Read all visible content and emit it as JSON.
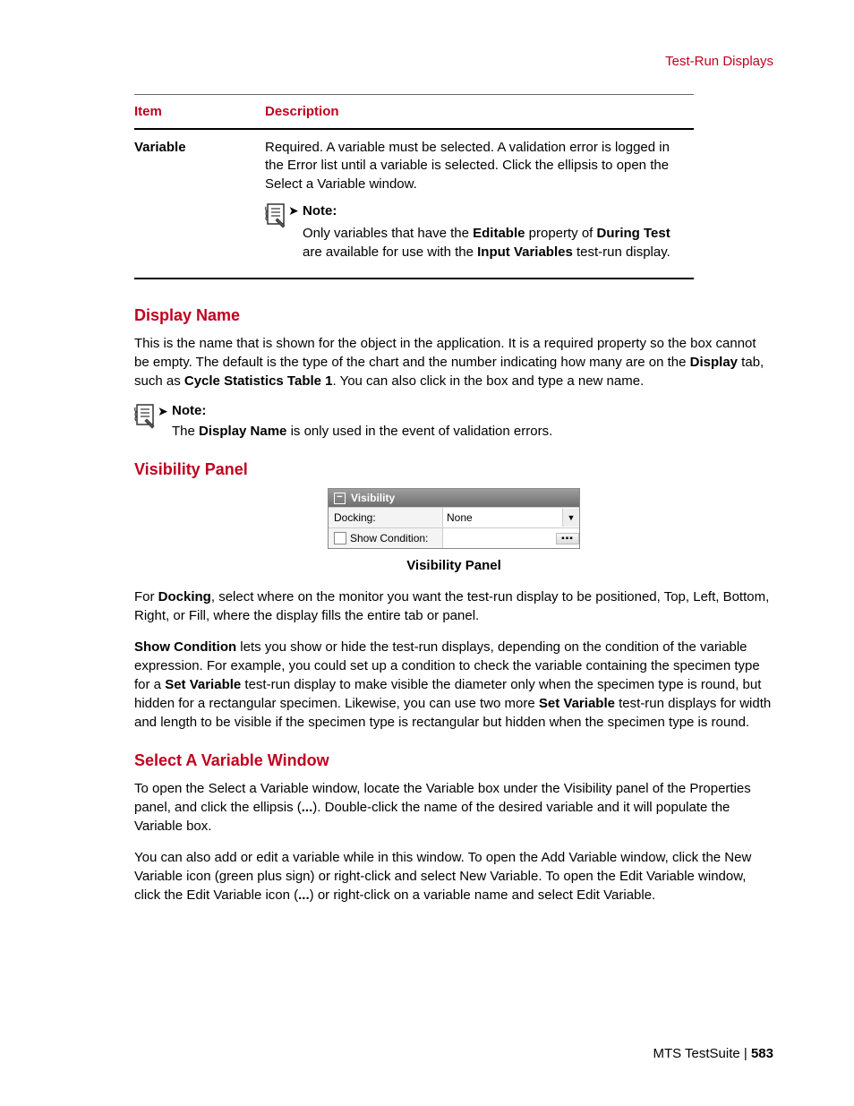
{
  "header": {
    "section": "Test-Run Displays"
  },
  "table": {
    "headers": {
      "item": "Item",
      "desc": "Description"
    },
    "row": {
      "item": "Variable",
      "desc": "Required. A variable must be selected. A validation error is logged in the Error list until a variable is selected. Click the ellipsis to open the Select a Variable window."
    },
    "note": {
      "title": "Note:",
      "pre": "Only variables that have the ",
      "b1": "Editable",
      "mid1": " property of ",
      "b2": "During Test",
      "mid2": " are available for use with the ",
      "b3": "Input Variables",
      "post": " test-run display."
    }
  },
  "displayName": {
    "heading": "Display Name",
    "para": {
      "pre": "This is the name that is shown for the object in the application. It is a required property so the box cannot be empty. The default is the type of the chart and the number indicating how many are on the ",
      "b1": "Display",
      "mid": " tab, such as ",
      "b2": "Cycle Statistics Table 1",
      "post": ". You can also click in the box and type a new name."
    },
    "note": {
      "title": "Note:",
      "pre": "The ",
      "b1": "Display Name",
      "post": " is only used in the event of validation errors."
    }
  },
  "visibility": {
    "heading": "Visibility Panel",
    "panel": {
      "title": "Visibility",
      "docking_label": "Docking:",
      "docking_value": "None",
      "showcond_label": "Show Condition:",
      "showcond_value": ""
    },
    "caption": "Visibility Panel",
    "para1": {
      "pre": "For ",
      "b1": "Docking",
      "post": ", select where on the monitor you want the test-run display to be positioned, Top, Left, Bottom, Right, or Fill, where the display fills the entire tab or panel."
    },
    "para2": {
      "b1": "Show Condition",
      "mid1": " lets you show or hide the test-run displays, depending on the condition of the variable expression. For example, you could set up a condition to check the variable containing the specimen type for a ",
      "b2": "Set Variable",
      "mid2": " test-run display to make visible the diameter only when the specimen type is round, but hidden for a rectangular specimen. Likewise, you can use two more ",
      "b3": "Set Variable",
      "post": " test-run displays for width and length to be visible if the specimen type is rectangular but hidden when the specimen type is round."
    }
  },
  "selectVar": {
    "heading": "Select A Variable Window",
    "para1": {
      "pre": "To open the Select a Variable window, locate the Variable box under the Visibility panel of the Properties panel, and click the ellipsis (",
      "b1": "...",
      "post": "). Double-click the name of the desired variable and it will populate the Variable box."
    },
    "para2": {
      "pre": "You can also add or edit a variable while in this window. To open the Add Variable window, click the New Variable icon (green plus sign) or right-click and select New Variable. To open the Edit Variable window, click the Edit Variable icon (",
      "b1": "...",
      "post": ") or right-click on a variable name and select Edit Variable."
    }
  },
  "footer": {
    "product": "MTS TestSuite",
    "sep": " | ",
    "page": "583"
  }
}
